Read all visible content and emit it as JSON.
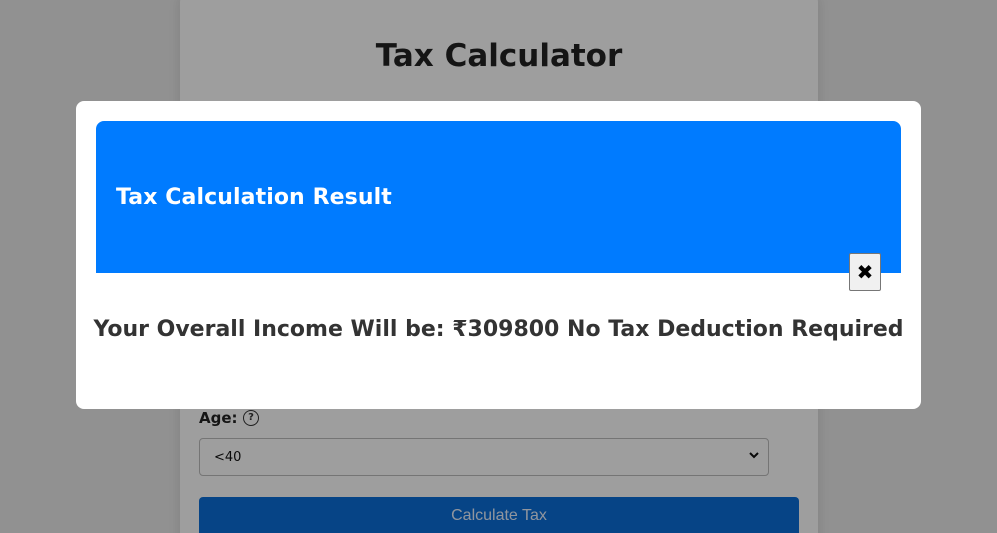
{
  "page": {
    "title": "Tax Calculator",
    "age_label": "Age:",
    "age_help_icon": "?",
    "age_select_value": "<40",
    "calculate_button_label": "Calculate Tax"
  },
  "modal": {
    "title": "Tax Calculation Result",
    "close_icon": "✖",
    "result_text": "Your Overall Income Will be: ₹309800 No Tax Deduction Required"
  },
  "colors": {
    "modal_header": "#007bff",
    "calculate_button": "#0a6fd8",
    "overlay": "rgba(0,0,0,0.38)"
  }
}
